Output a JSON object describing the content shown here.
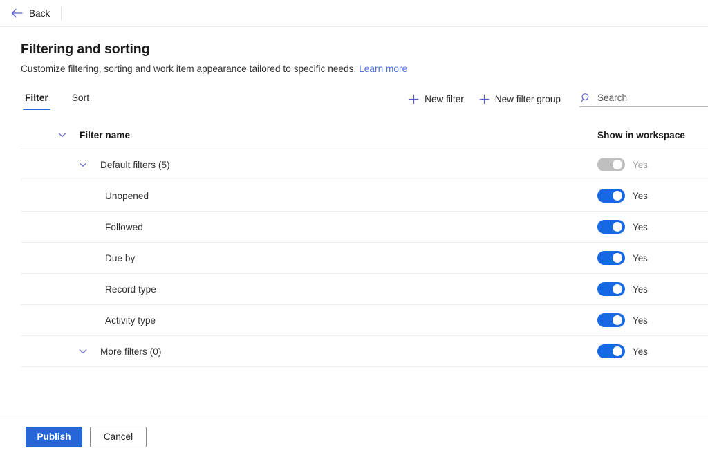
{
  "topbar": {
    "back_label": "Back",
    "back_icon": "arrow-left-icon"
  },
  "header": {
    "title": "Filtering and sorting",
    "subtitle": "Customize filtering, sorting and work item appearance tailored to specific needs.",
    "learn_more_label": "Learn more"
  },
  "tabs": [
    {
      "label": "Filter",
      "active": true
    },
    {
      "label": "Sort",
      "active": false
    }
  ],
  "toolbar": {
    "new_filter_label": "New filter",
    "new_filter_group_label": "New filter group",
    "new_filter_icon": "plus-icon",
    "new_filter_group_icon": "plus-icon",
    "search_icon": "search-icon",
    "search_placeholder": "Search",
    "search_value": ""
  },
  "table": {
    "columns": {
      "name": "Filter name",
      "show_in_workspace": "Show in workspace"
    },
    "rows": [
      {
        "label": "Default filters (5)",
        "level": 1,
        "chevron": "chevron-down-icon",
        "toggle_on": true,
        "toggle_disabled": true,
        "toggle_label": "Yes"
      },
      {
        "label": "Unopened",
        "level": 2,
        "chevron": null,
        "toggle_on": true,
        "toggle_disabled": false,
        "toggle_label": "Yes"
      },
      {
        "label": "Followed",
        "level": 2,
        "chevron": null,
        "toggle_on": true,
        "toggle_disabled": false,
        "toggle_label": "Yes"
      },
      {
        "label": "Due by",
        "level": 2,
        "chevron": null,
        "toggle_on": true,
        "toggle_disabled": false,
        "toggle_label": "Yes"
      },
      {
        "label": "Record type",
        "level": 2,
        "chevron": null,
        "toggle_on": true,
        "toggle_disabled": false,
        "toggle_label": "Yes"
      },
      {
        "label": "Activity type",
        "level": 2,
        "chevron": null,
        "toggle_on": true,
        "toggle_disabled": false,
        "toggle_label": "Yes"
      },
      {
        "label": "More filters (0)",
        "level": 1,
        "chevron": "chevron-down-icon",
        "toggle_on": true,
        "toggle_disabled": false,
        "toggle_label": "Yes"
      }
    ]
  },
  "footer": {
    "publish_label": "Publish",
    "cancel_label": "Cancel"
  },
  "colors": {
    "accent_blue": "#2665d8",
    "toggle_on": "#1668e3",
    "toggle_disabled": "#bfbfbf",
    "link": "#4a6ee0",
    "tab_underline": "#2a68d8"
  }
}
